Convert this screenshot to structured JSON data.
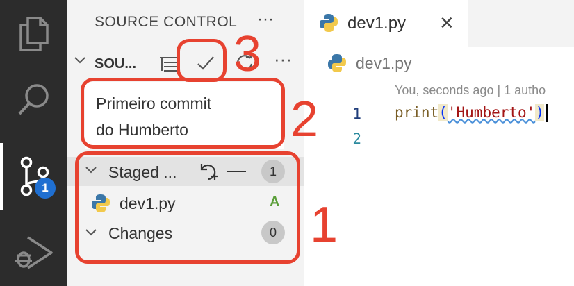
{
  "activity_bar": {
    "items": [
      "explorer",
      "search",
      "source-control",
      "run-debug"
    ],
    "scm_badge": "1"
  },
  "sidebar": {
    "title": "SOURCE CONTROL",
    "more": "···",
    "repo": {
      "name": "SOU...",
      "actions": [
        "view-as-tree",
        "commit",
        "refresh",
        "more"
      ],
      "more": "···"
    },
    "commit_message": [
      "Primeiro commit",
      "do Humberto"
    ],
    "staged": {
      "label": "Staged ...",
      "count": "1",
      "files": [
        {
          "name": "dev1.py",
          "status": "A"
        }
      ]
    },
    "changes": {
      "label": "Changes",
      "count": "0"
    }
  },
  "editor": {
    "tab": {
      "label": "dev1.py",
      "close": "✕"
    },
    "breadcrumb": "dev1.py",
    "blame": "You, seconds ago | 1 autho",
    "line_numbers": [
      "1",
      "2"
    ],
    "code": {
      "func": "print",
      "open": "(",
      "string": "'Humberto'",
      "close": ")"
    }
  },
  "annotations": [
    {
      "label": "1"
    },
    {
      "label": "2"
    },
    {
      "label": "3"
    }
  ],
  "colors": {
    "annotation": "#e74230",
    "badge": "#1f6fd1",
    "activity_bg": "#2c2c2c"
  }
}
